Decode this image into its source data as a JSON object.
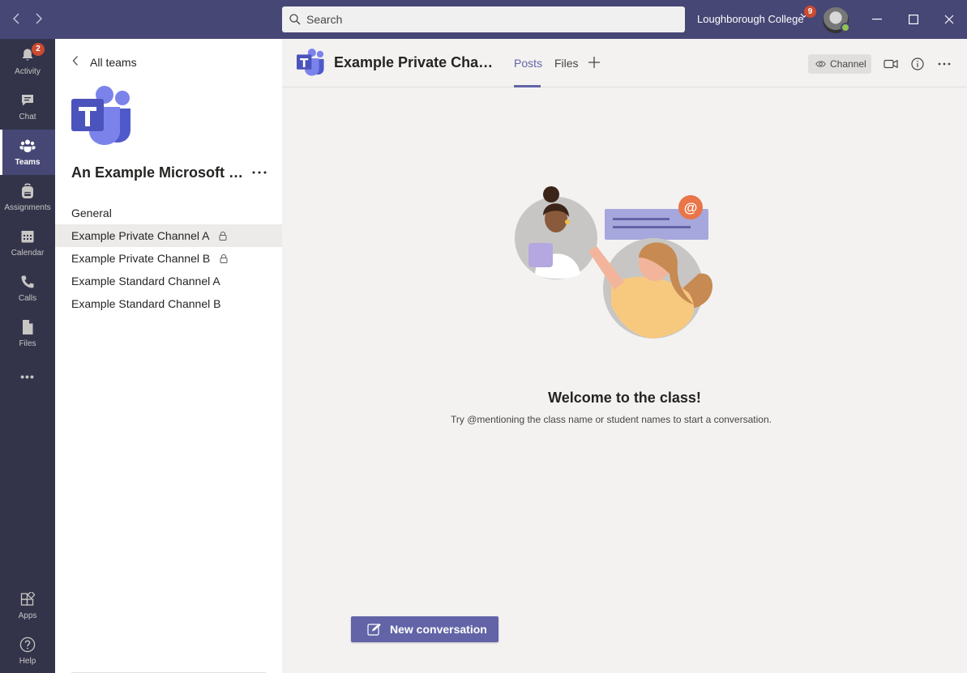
{
  "titlebar": {
    "search_placeholder": "Search",
    "org_name": "Loughborough College",
    "org_badge": "9"
  },
  "rail": {
    "items": [
      {
        "label": "Activity",
        "badge": "2"
      },
      {
        "label": "Chat"
      },
      {
        "label": "Teams"
      },
      {
        "label": "Assignments"
      },
      {
        "label": "Calendar"
      },
      {
        "label": "Calls"
      },
      {
        "label": "Files"
      },
      {
        "label": "Apps"
      },
      {
        "label": "Help"
      }
    ],
    "more_label": "•••"
  },
  "team_panel": {
    "back_label": "All teams",
    "team_name": "An Example Microsoft Teams Class",
    "channels": [
      {
        "label": "General"
      },
      {
        "label": "Example Private Channel A"
      },
      {
        "label": "Example Private Channel B"
      },
      {
        "label": "Example Standard Channel A"
      },
      {
        "label": "Example Standard Channel B"
      }
    ]
  },
  "channel_header": {
    "title": "Example Private Channel A",
    "tabs": [
      {
        "label": "Posts"
      },
      {
        "label": "Files"
      }
    ],
    "add_tab": "+",
    "channel_chip": "Channel"
  },
  "main": {
    "welcome_title": "Welcome to the class!",
    "welcome_subtitle": "Try @mentioning the class name or student names to start a conversation.",
    "new_conversation_label": "New conversation"
  },
  "colors": {
    "accent": "#6264a7",
    "titlebar": "#464775",
    "rail": "#33344a",
    "badge": "#cc4a31",
    "presence": "#92c353"
  }
}
